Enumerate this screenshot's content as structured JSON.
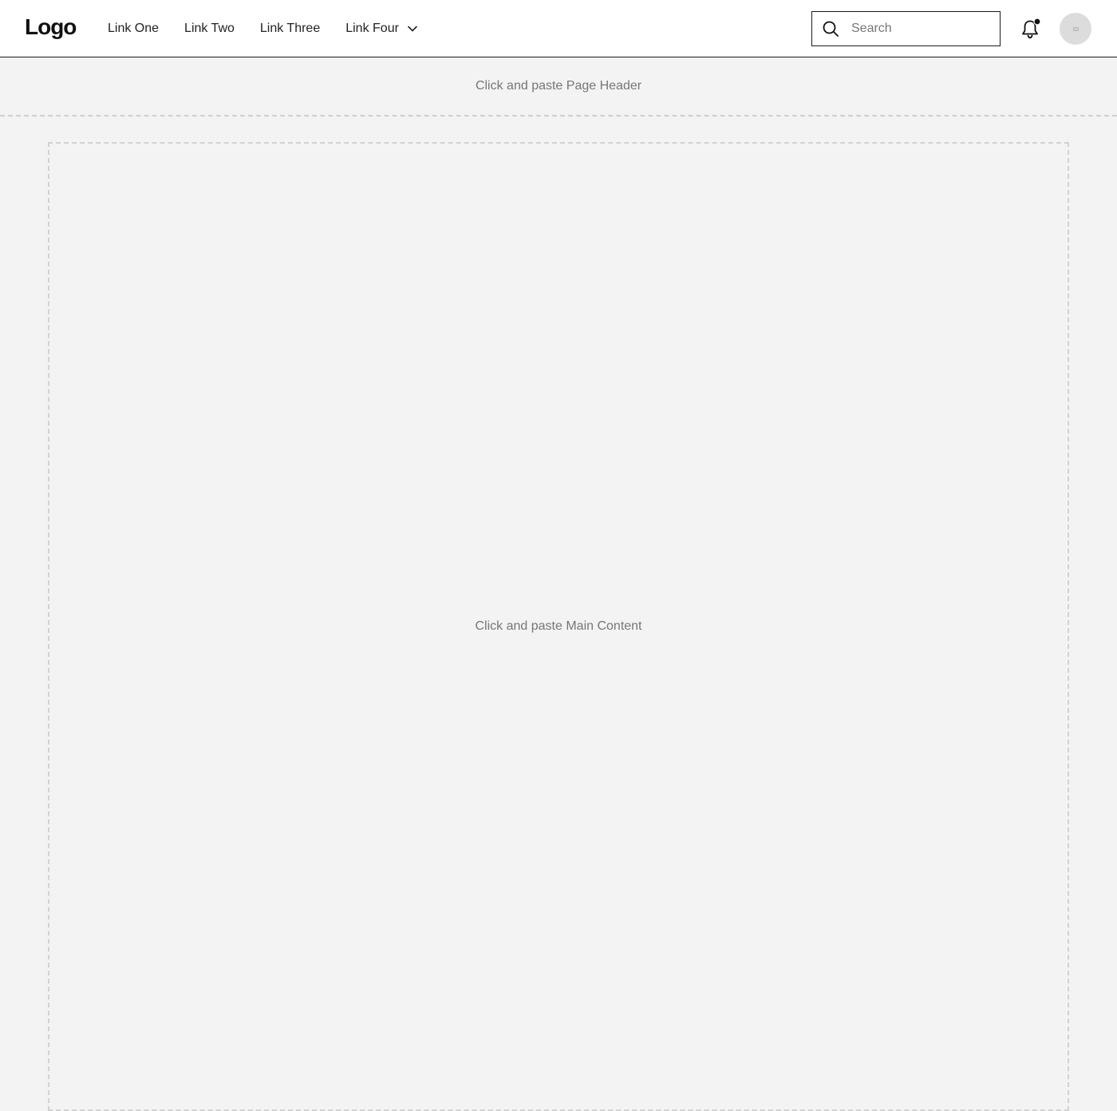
{
  "navbar": {
    "logo": "Logo",
    "links": [
      {
        "label": "Link One"
      },
      {
        "label": "Link Two"
      },
      {
        "label": "Link Three"
      },
      {
        "label": "Link Four",
        "has_dropdown": true
      }
    ],
    "search": {
      "placeholder": "Search",
      "value": ""
    },
    "notification_icon": "bell-icon",
    "notification_badge_color": "#111111",
    "avatar_icon": "avatar"
  },
  "page_header": {
    "text": "Click and paste Page Header"
  },
  "main": {
    "text": "Click and paste Main Content"
  },
  "colors": {
    "background": "#f3f3f3",
    "navbar_bg": "#ffffff",
    "placeholder_text": "#767676",
    "dashed_border": "#cfcfcf"
  }
}
